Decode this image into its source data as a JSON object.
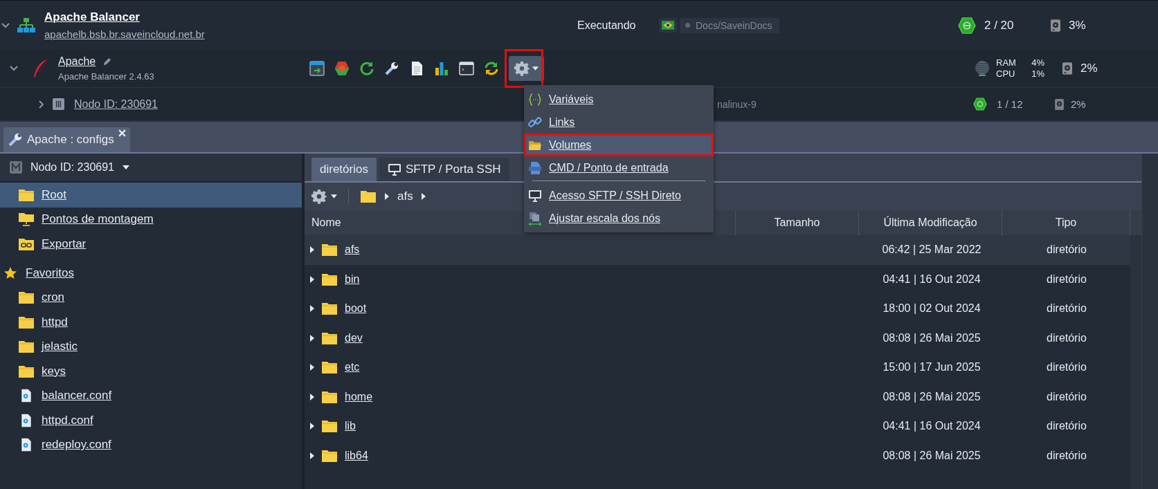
{
  "environment": {
    "name": "Apache Balancer",
    "domain": "apachelb.bsb.br.saveincloud.net.br",
    "status": "Executando",
    "tag": "Docs/SaveinDocs",
    "cloudlets": "2 / 20",
    "disk": "3%"
  },
  "node_group": {
    "name": "Apache",
    "version": "Apache Balancer 2.4.63",
    "ram_label": "RAM",
    "ram": "4%",
    "cpu_label": "CPU",
    "cpu": "1%",
    "disk": "2%"
  },
  "node": {
    "name": "Nodo ID: 230691",
    "os": "nalinux-9",
    "cloudlets": "1 / 12",
    "disk": "2%"
  },
  "menu": {
    "items": [
      {
        "label": "Variáveis",
        "kind": "variables",
        "selected": false,
        "separator_before": false
      },
      {
        "label": "Links",
        "kind": "links",
        "selected": false,
        "separator_before": false
      },
      {
        "label": "Volumes",
        "kind": "volumes",
        "selected": true,
        "separator_before": false
      },
      {
        "label": "CMD / Ponto de entrada",
        "kind": "cmd",
        "selected": false,
        "separator_before": false
      },
      {
        "label": "Acesso SFTP / SSH Direto",
        "kind": "ssh",
        "selected": false,
        "separator_before": true
      },
      {
        "label": "Ajustar escala dos nós",
        "kind": "scale",
        "selected": false,
        "separator_before": false
      }
    ]
  },
  "panel_tab": {
    "label": "Apache : configs"
  },
  "left": {
    "node_selector": "Nodo ID: 230691",
    "items": [
      {
        "label": "Root",
        "kind": "folder",
        "selected": true
      },
      {
        "label": "Pontos de montagem",
        "kind": "mount",
        "selected": false
      },
      {
        "label": "Exportar",
        "kind": "export",
        "selected": false
      }
    ],
    "favorites_label": "Favoritos",
    "favorites": [
      {
        "label": "cron",
        "kind": "folder"
      },
      {
        "label": "httpd",
        "kind": "folder"
      },
      {
        "label": "jelastic",
        "kind": "folder"
      },
      {
        "label": "keys",
        "kind": "folder"
      },
      {
        "label": "balancer.conf",
        "kind": "file"
      },
      {
        "label": "httpd.conf",
        "kind": "file"
      },
      {
        "label": "redeploy.conf",
        "kind": "file"
      }
    ]
  },
  "right": {
    "tabs": [
      {
        "label": "diretórios",
        "selected": true
      },
      {
        "label": "SFTP / Porta SSH",
        "selected": false
      }
    ],
    "breadcrumb": [
      "afs"
    ],
    "columns": [
      "Nome",
      "Tamanho",
      "Última Modificação",
      "Tipo"
    ],
    "rows": [
      {
        "name": "afs",
        "modified": "06:42 | 25 Mar 2022",
        "type": "diretório",
        "selected": true
      },
      {
        "name": "bin",
        "modified": "04:41 | 16 Out 2024",
        "type": "diretório",
        "selected": false
      },
      {
        "name": "boot",
        "modified": "18:00 | 02 Out 2024",
        "type": "diretório",
        "selected": false
      },
      {
        "name": "dev",
        "modified": "08:08 | 26 Mai 2025",
        "type": "diretório",
        "selected": false
      },
      {
        "name": "etc",
        "modified": "15:00 | 17 Jun 2025",
        "type": "diretório",
        "selected": false
      },
      {
        "name": "home",
        "modified": "08:08 | 26 Mai 2025",
        "type": "diretório",
        "selected": false
      },
      {
        "name": "lib",
        "modified": "04:41 | 16 Out 2024",
        "type": "diretório",
        "selected": false
      },
      {
        "name": "lib64",
        "modified": "08:08 | 26 Mai 2025",
        "type": "diretório",
        "selected": false
      }
    ]
  }
}
